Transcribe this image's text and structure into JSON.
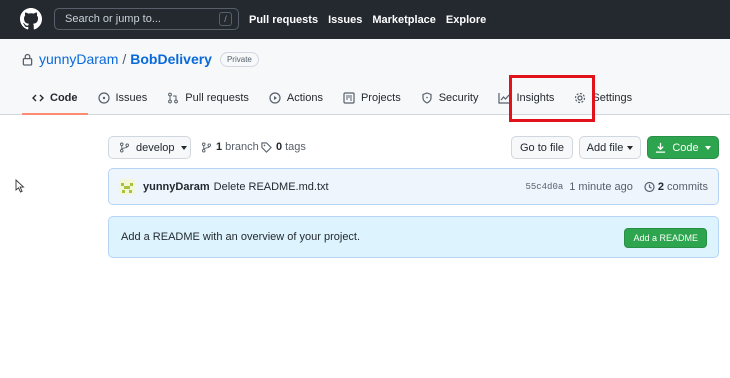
{
  "header": {
    "search_placeholder": "Search or jump to...",
    "search_key": "/",
    "nav": [
      "Pull requests",
      "Issues",
      "Marketplace",
      "Explore"
    ]
  },
  "repo": {
    "owner": "yunnyDaram",
    "separator": "/",
    "name": "BobDelivery",
    "visibility": "Private"
  },
  "tabs": [
    {
      "label": "Code",
      "icon": "code-icon",
      "active": true
    },
    {
      "label": "Issues",
      "icon": "issue-icon",
      "active": false
    },
    {
      "label": "Pull requests",
      "icon": "pull-request-icon",
      "active": false
    },
    {
      "label": "Actions",
      "icon": "play-icon",
      "active": false
    },
    {
      "label": "Projects",
      "icon": "project-icon",
      "active": false
    },
    {
      "label": "Security",
      "icon": "shield-icon",
      "active": false
    },
    {
      "label": "Insights",
      "icon": "graph-icon",
      "active": false
    },
    {
      "label": "Settings",
      "icon": "gear-icon",
      "active": false
    }
  ],
  "toolbar": {
    "branch": "develop",
    "branch_count": "1",
    "branch_label": "branch",
    "tag_count": "0",
    "tag_label": "tags",
    "go_to_file": "Go to file",
    "add_file": "Add file",
    "code": "Code"
  },
  "commit": {
    "author": "yunnyDaram",
    "message": "Delete README.md.txt",
    "sha": "55c4d0a",
    "time": "1 minute ago",
    "count": "2",
    "count_label": "commits"
  },
  "readme": {
    "text": "Add a README with an overview of your project.",
    "button": "Add a README"
  },
  "colors": {
    "header_bg": "#24292f",
    "accent_link": "#0969da",
    "primary_green": "#2da44e",
    "active_tab_underline": "#fd8c73",
    "highlight_box": "#e0131b"
  }
}
